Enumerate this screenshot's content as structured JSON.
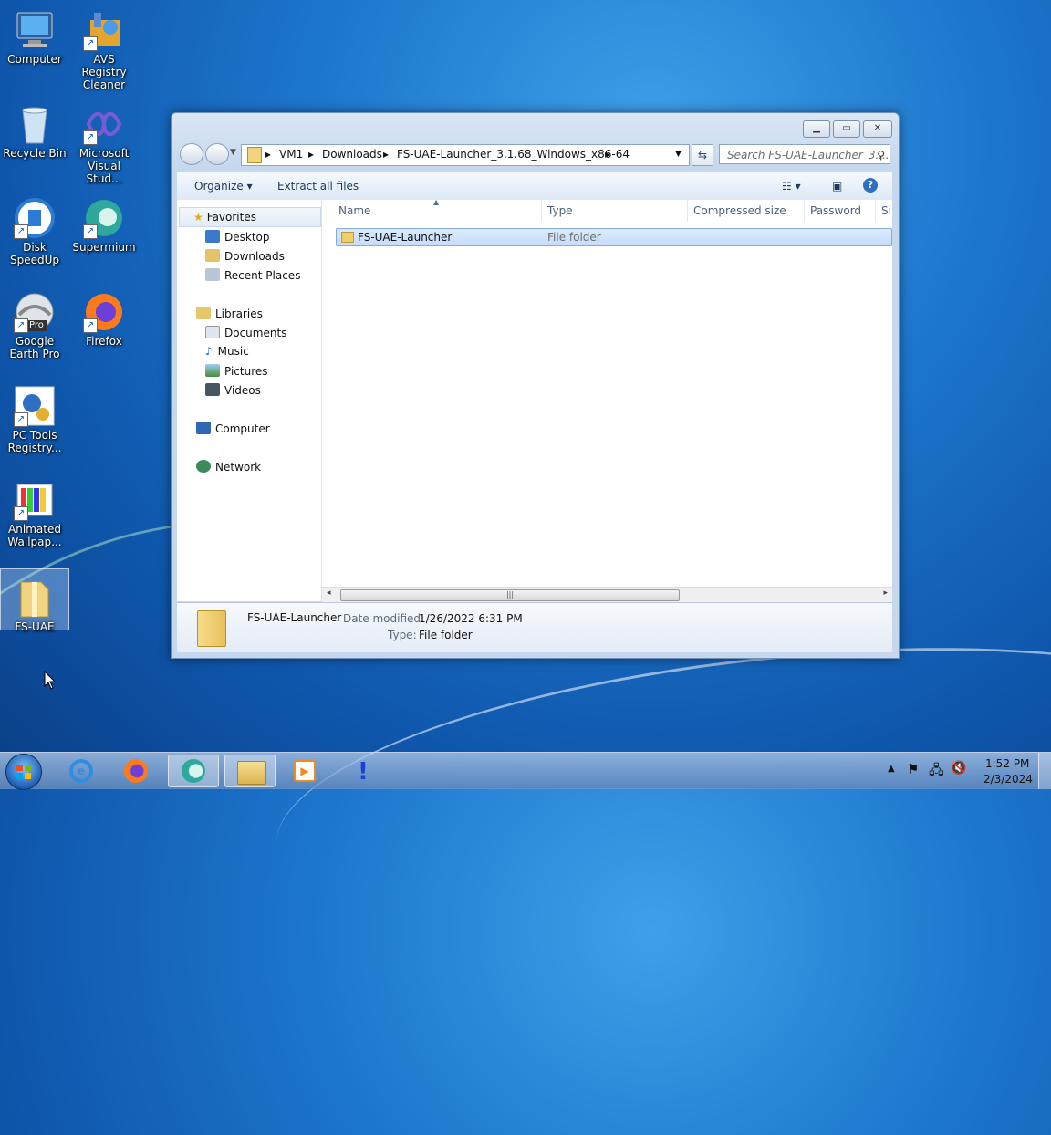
{
  "desktop": {
    "icons": [
      {
        "label": "Computer",
        "icon": "computer-icon"
      },
      {
        "label": "AVS Registry Cleaner",
        "icon": "avs-registry-cleaner-icon"
      },
      {
        "label": "Recycle Bin",
        "icon": "recycle-bin-icon"
      },
      {
        "label": "Microsoft Visual Stud...",
        "icon": "visual-studio-icon"
      },
      {
        "label": "Disk SpeedUp",
        "icon": "disk-speedup-icon"
      },
      {
        "label": "Supermium",
        "icon": "supermium-icon"
      },
      {
        "label": "Google Earth Pro",
        "icon": "google-earth-icon",
        "badge": "Pro"
      },
      {
        "label": "Firefox",
        "icon": "firefox-icon"
      },
      {
        "label": "PC Tools Registry...",
        "icon": "pc-tools-icon"
      },
      {
        "label": "Animated Wallpap...",
        "icon": "animated-wallpaper-icon"
      },
      {
        "label": "FS-UAE",
        "icon": "zip-folder-icon"
      }
    ]
  },
  "window": {
    "breadcrumb": [
      "VM1",
      "Downloads",
      "FS-UAE-Launcher_3.1.68_Windows_x86-64"
    ],
    "search_placeholder": "Search FS-UAE-Launcher_3....",
    "toolbar": {
      "organize": "Organize",
      "extract": "Extract all files"
    },
    "nav": {
      "favorites": "Favorites",
      "desktop": "Desktop",
      "downloads": "Downloads",
      "recent": "Recent Places",
      "libraries": "Libraries",
      "documents": "Documents",
      "music": "Music",
      "pictures": "Pictures",
      "videos": "Videos",
      "computer": "Computer",
      "network": "Network"
    },
    "columns": [
      "Name",
      "Type",
      "Compressed size",
      "Password ...",
      "Si"
    ],
    "rows": [
      {
        "name": "FS-UAE-Launcher",
        "type": "File folder"
      }
    ],
    "details": {
      "name": "FS-UAE-Launcher",
      "date_label": "Date modified:",
      "date_value": "1/26/2022 6:31 PM",
      "type_label": "Type:",
      "type_value": "File folder"
    }
  },
  "taskbar": {
    "time": "1:52 PM",
    "date": "2/3/2024"
  },
  "colors": {
    "accent": "#1e78cf",
    "selection": "#c4ddfb"
  }
}
